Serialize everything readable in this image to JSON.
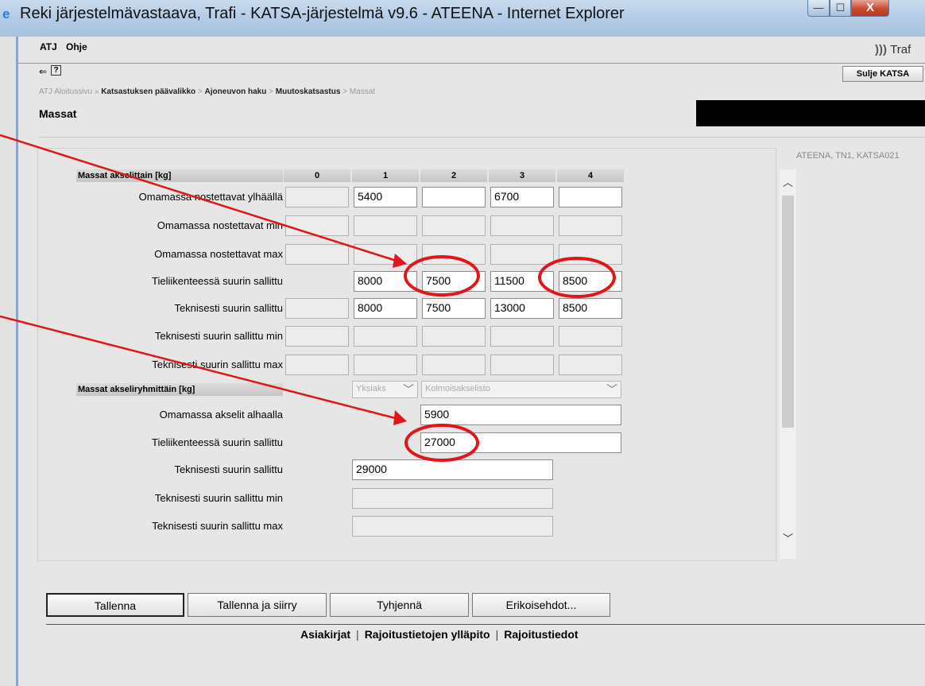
{
  "window": {
    "title": "Reki järjestelmävastaava, Trafi - KATSA-järjestelmä v9.6 - ATEENA - Internet Explorer",
    "min_glyph": "—",
    "max_glyph": "☐",
    "close_glyph": "X"
  },
  "menu": {
    "items": [
      "ATJ",
      "Ohje"
    ]
  },
  "logo_text": "Traf",
  "toolbar": {
    "back_glyph": "⇐",
    "help_glyph": "?",
    "close_katsa": "Sulje KATSA"
  },
  "breadcrumb": {
    "items": [
      "ATJ Aloitussivu",
      "Katsastuksen päävalikko",
      "Ajoneuvon haku",
      "Muutoskatsastus",
      "Massat"
    ],
    "sep1": "»",
    "sep": ">"
  },
  "page_title": "Massat",
  "system_info": "ATEENA, TN1, KATSA021",
  "axle_table": {
    "header": "Massat akselittain [kg]",
    "columns": [
      "0",
      "1",
      "2",
      "3",
      "4"
    ],
    "rows": [
      {
        "label": "Omamassa nostettavat ylhäällä",
        "values": [
          "",
          "5400",
          "",
          "6700",
          ""
        ]
      },
      {
        "label": "Omamassa nostettavat min",
        "values": [
          "",
          "",
          "",
          "",
          ""
        ]
      },
      {
        "label": "Omamassa nostettavat max",
        "values": [
          "",
          "",
          "",
          "",
          ""
        ]
      },
      {
        "label": "Tieliikenteessä suurin sallittu",
        "values": [
          "",
          "8000",
          "7500",
          "11500",
          "8500"
        ]
      },
      {
        "label": "Teknisesti suurin sallittu",
        "values": [
          "",
          "8000",
          "7500",
          "13000",
          "8500"
        ]
      },
      {
        "label": "Teknisesti suurin sallittu min",
        "values": [
          "",
          "",
          "",
          "",
          ""
        ]
      },
      {
        "label": "Teknisesti suurin sallittu max",
        "values": [
          "",
          "",
          "",
          "",
          ""
        ]
      }
    ]
  },
  "group_table": {
    "header": "Massat akseliryhmittäin [kg]",
    "select1": "Yksiaks",
    "select2": "Kolmoisakselisto",
    "rows": [
      {
        "label": "Omamassa akselit alhaalla",
        "value": "5900"
      },
      {
        "label": "Tieliikenteessä suurin sallittu",
        "value": "27000"
      },
      {
        "label": "Teknisesti suurin sallittu",
        "value": "29000"
      },
      {
        "label": "Teknisesti suurin sallittu min",
        "value": ""
      },
      {
        "label": "Teknisesti suurin sallittu max",
        "value": ""
      }
    ]
  },
  "buttons": {
    "save": "Tallenna",
    "save_move": "Tallenna ja siirry",
    "clear": "Tyhjennä",
    "special": "Erikoisehdot..."
  },
  "footer_links": [
    "Asiakirjat",
    "Rajoitustietojen ylläpito",
    "Rajoitustiedot"
  ],
  "footer_sep": "|",
  "annotation_color": "#e0161b",
  "icons": {
    "browser": "ie-icon",
    "scroll_up": "chevron-up-icon",
    "scroll_down": "chevron-down-icon"
  }
}
